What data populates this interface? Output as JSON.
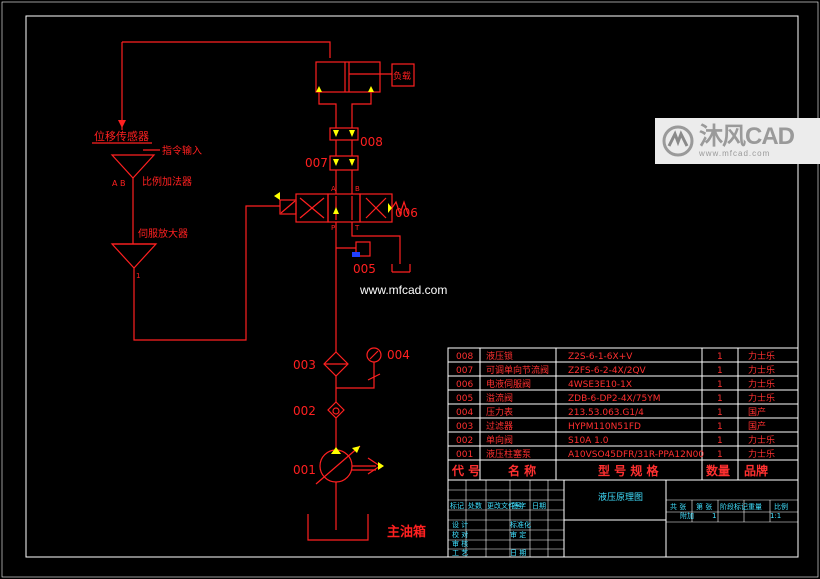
{
  "diagram": {
    "labels": {
      "load": "负载",
      "displacement_sensor": "位移传感器",
      "command_input": "指令输入",
      "amplifier_marks": "A B",
      "proportional_adder": "比例加法器",
      "servo_amplifier": "伺服放大器",
      "servo_amp_mark": "1",
      "valve_port_a": "A",
      "valve_port_b": "B",
      "valve_port_p": "P",
      "valve_port_t": "T",
      "main_tank": "主油箱",
      "site_url": "www.mfcad.com"
    },
    "component_ids": [
      "001",
      "002",
      "003",
      "004",
      "005",
      "006",
      "007",
      "008"
    ]
  },
  "parts_table": {
    "rows": [
      {
        "code": "008",
        "name": "液压锁",
        "model": "Z2S-6-1-6X+V",
        "qty": "1",
        "brand": "力士乐"
      },
      {
        "code": "007",
        "name": "可调单向节流阀",
        "model": "Z2FS-6-2-4X/2QV",
        "qty": "1",
        "brand": "力士乐"
      },
      {
        "code": "006",
        "name": "电液伺服阀",
        "model": "4WSE3E10-1X",
        "qty": "1",
        "brand": "力士乐"
      },
      {
        "code": "005",
        "name": "溢流阀",
        "model": "ZDB-6-DP2-4X/75YM",
        "qty": "1",
        "brand": "力士乐"
      },
      {
        "code": "004",
        "name": "压力表",
        "model": "213.53.063.G1/4",
        "qty": "1",
        "brand": "国产"
      },
      {
        "code": "003",
        "name": "过滤器",
        "model": "HYPM110N51FD",
        "qty": "1",
        "brand": "国产"
      },
      {
        "code": "002",
        "name": "单向阀",
        "model": "S10A 1.0",
        "qty": "1",
        "brand": "力士乐"
      },
      {
        "code": "001",
        "name": "液压柱塞泵",
        "model": "A10VSO45DFR/31R-PPA12N00",
        "qty": "1",
        "brand": "力士乐"
      }
    ],
    "header": {
      "code": "代 号",
      "name": "名 称",
      "model": "型 号 规 格",
      "qty": "数量",
      "brand": "品牌"
    }
  },
  "title_block": {
    "drawing_title": "液压原理图",
    "left_cells": [
      "标记",
      "处数",
      "更改文件号",
      "签字",
      "日期",
      "设 计",
      "标准化",
      "校 对",
      "审 定",
      "审 核",
      "工 艺",
      "日 期"
    ],
    "right_headers": [
      "共 张",
      "第 张",
      "阶段标记",
      "重量",
      "比例"
    ],
    "qty": "1",
    "scale": "1:1",
    "sheet": "附加"
  },
  "watermark": {
    "brand": "沐风CAD",
    "url": "www.mfcad.com"
  },
  "colors": {
    "background": "#000000",
    "lines": "#ff2020",
    "frame": "#ffffff",
    "ports": "#ffff00",
    "annotation": "#40e0ff"
  }
}
